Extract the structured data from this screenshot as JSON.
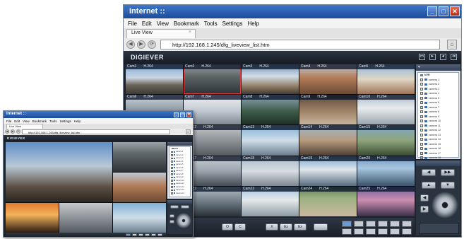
{
  "big_window": {
    "title": "Internet ::",
    "menu": [
      "File",
      "Edit",
      "View",
      "Bookmark",
      "Tools",
      "Settings",
      "Help"
    ],
    "tab_label": "Live View",
    "tab_close": "×",
    "url": "http://192.168.1.245/dfg_liveview_list.htm",
    "brand": "DIGIEVER",
    "cameras": [
      {
        "label": "Cam1",
        "res": "H.264"
      },
      {
        "label": "Cam2",
        "res": "H.264"
      },
      {
        "label": "Cam3",
        "res": "H.264"
      },
      {
        "label": "Cam4",
        "res": "H.264"
      },
      {
        "label": "Cam5",
        "res": "H.264"
      },
      {
        "label": "Cam6",
        "res": "H.264"
      },
      {
        "label": "Cam7",
        "res": "H.264"
      },
      {
        "label": "Cam8",
        "res": "H.264"
      },
      {
        "label": "Cam9",
        "res": "H.264"
      },
      {
        "label": "Cam10",
        "res": "H.264"
      },
      {
        "label": "Cam11",
        "res": "H.264"
      },
      {
        "label": "Cam12",
        "res": "H.264"
      },
      {
        "label": "Cam13",
        "res": "H.264"
      },
      {
        "label": "Cam14",
        "res": "H.264"
      },
      {
        "label": "Cam15",
        "res": "H.264"
      },
      {
        "label": "Cam16",
        "res": "H.264"
      },
      {
        "label": "Cam17",
        "res": "H.264"
      },
      {
        "label": "Cam18",
        "res": "H.264"
      },
      {
        "label": "Cam19",
        "res": "H.264"
      },
      {
        "label": "Cam20",
        "res": "H.264"
      },
      {
        "label": "Cam21",
        "res": "H.264"
      },
      {
        "label": "Cam22",
        "res": "H.264"
      },
      {
        "label": "Cam23",
        "res": "H.264"
      },
      {
        "label": "Cam24",
        "res": "H.264"
      },
      {
        "label": "Cam25",
        "res": "H.264"
      }
    ],
    "tree_root": "NVR",
    "tree_items": [
      "camera 1",
      "camera 2",
      "camera 3",
      "camera 4",
      "camera 5",
      "camera 6",
      "camera 7",
      "camera 8",
      "camera 9",
      "camera 10",
      "camera 11",
      "camera 12",
      "camera 13",
      "camera 14",
      "camera 15",
      "camera 16",
      "camera 17",
      "camera 18"
    ],
    "bottom_buttons": [
      "■▸",
      "O",
      "C",
      "X",
      "Ex",
      "Ex",
      ""
    ],
    "ptz_buttons": [
      "◀",
      "▶▶",
      "▲",
      "▼",
      "◀",
      "▶"
    ]
  },
  "small_window": {
    "title": "Internet ::",
    "menu": [
      "File",
      "Edit",
      "View",
      "Bookmark",
      "Tools",
      "Settings",
      "Help"
    ],
    "tab_label": "Live View",
    "url": "http://192.168.1.245/dfg_liveview_list.htm",
    "brand": "DIGIEVER"
  },
  "colors": {
    "titlebar": "#2a5db0",
    "app_bg": "#1c232c",
    "selection": "#e03a3a"
  }
}
